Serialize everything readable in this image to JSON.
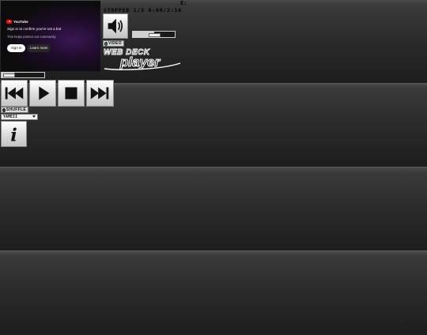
{
  "youtube": {
    "logo_text": "YouTube",
    "message": "Sign in to confirm you're not a bot",
    "sub_message": "This helps protect our community",
    "sign_in_label": "Sign in",
    "learn_more_label": "Learn more"
  },
  "status": {
    "corner_text": "E:",
    "state_text": "STOPPED 1/3 0:00/2:16"
  },
  "toggles": {
    "video_label": "VIDEO",
    "video_on": true,
    "shuffle_label": "SHUFFLE",
    "shuffle_on": false
  },
  "volume": {
    "level": 0.5
  },
  "seek": {
    "position": 0.3
  },
  "logo": {
    "line1": "WEB DECK",
    "line2": "player"
  },
  "playlist_select": {
    "selected": "YAMEII"
  },
  "controls": {
    "previous_icon": "skip-back-icon",
    "play_icon": "play-icon",
    "stop_icon": "stop-icon",
    "next_icon": "skip-forward-icon",
    "speaker_icon": "speaker-icon",
    "info_icon": "info-icon"
  }
}
